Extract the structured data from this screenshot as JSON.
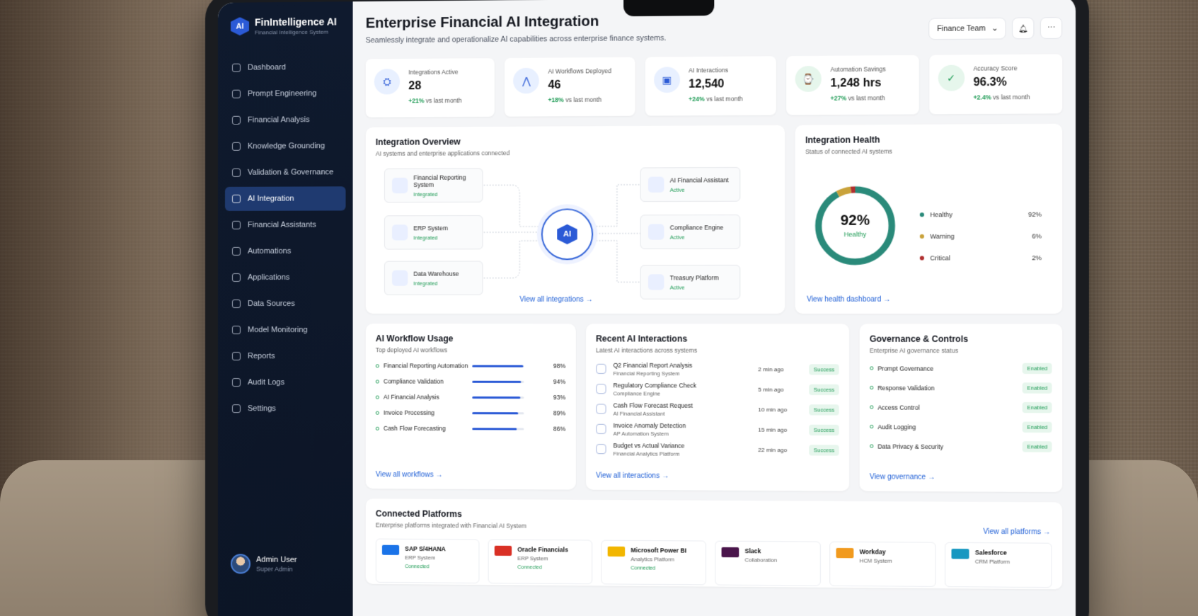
{
  "brand": {
    "name": "FinIntelligence AI",
    "sub": "Financial Intelligence System",
    "logo": "AI"
  },
  "nav": [
    {
      "label": "Dashboard",
      "icon": "home-icon"
    },
    {
      "label": "Prompt Engineering",
      "icon": "prompt-icon"
    },
    {
      "label": "Financial Analysis",
      "icon": "chart-icon"
    },
    {
      "label": "Knowledge Grounding",
      "icon": "knowledge-icon"
    },
    {
      "label": "Validation & Governance",
      "icon": "shield-icon"
    },
    {
      "label": "AI Integration",
      "icon": "integration-icon",
      "active": true
    },
    {
      "label": "Financial Assistants",
      "icon": "assistant-icon"
    },
    {
      "label": "Automations",
      "icon": "automation-icon"
    },
    {
      "label": "Applications",
      "icon": "apps-icon"
    },
    {
      "label": "Data Sources",
      "icon": "database-icon"
    },
    {
      "label": "Model Monitoring",
      "icon": "monitor-icon"
    },
    {
      "label": "Reports",
      "icon": "report-icon"
    },
    {
      "label": "Audit Logs",
      "icon": "log-icon"
    },
    {
      "label": "Settings",
      "icon": "gear-icon"
    }
  ],
  "user": {
    "name": "Admin User",
    "role": "Super Admin"
  },
  "header": {
    "title": "Enterprise Financial AI Integration",
    "subtitle": "Seamlessly integrate and operationalize AI capabilities across enterprise finance systems.",
    "team": "Finance Team"
  },
  "stats": [
    {
      "label": "Integrations Active",
      "value": "28",
      "delta": "+21%",
      "suffix": "vs last month",
      "color": "#e8f0ff",
      "ic": "⛭"
    },
    {
      "label": "AI Workflows Deployed",
      "value": "46",
      "delta": "+18%",
      "suffix": "vs last month",
      "color": "#e8f0ff",
      "ic": "⋀"
    },
    {
      "label": "AI Interactions",
      "value": "12,540",
      "delta": "+24%",
      "suffix": "vs last month",
      "color": "#e8f0ff",
      "ic": "▣"
    },
    {
      "label": "Automation Savings",
      "value": "1,248 hrs",
      "delta": "+27%",
      "suffix": "vs last month",
      "color": "#e6f6ec",
      "ic": "⌚"
    },
    {
      "label": "Accuracy Score",
      "value": "96.3%",
      "delta": "+2.4%",
      "suffix": "vs last month",
      "color": "#e6f6ec",
      "ic": "✓"
    }
  ],
  "overview": {
    "title": "Integration Overview",
    "subtitle": "AI systems and enterprise applications connected",
    "hub": "AI",
    "left": [
      {
        "name": "Financial Reporting System",
        "status": "Integrated"
      },
      {
        "name": "ERP System",
        "status": "Integrated"
      },
      {
        "name": "Data Warehouse",
        "status": "Integrated"
      }
    ],
    "right": [
      {
        "name": "AI Financial Assistant",
        "status": "Active"
      },
      {
        "name": "Compliance Engine",
        "status": "Active"
      },
      {
        "name": "Treasury Platform",
        "status": "Active"
      }
    ],
    "link": "View all integrations →"
  },
  "health": {
    "title": "Integration Health",
    "subtitle": "Status of connected AI systems",
    "center_value": "92%",
    "center_label": "Healthy",
    "items": [
      {
        "label": "Healthy",
        "pct": "92%",
        "value": 92,
        "color": "#2a8a7a"
      },
      {
        "label": "Warning",
        "pct": "6%",
        "value": 6,
        "color": "#c9a23a"
      },
      {
        "label": "Critical",
        "pct": "2%",
        "value": 2,
        "color": "#b03030"
      }
    ],
    "link": "View health dashboard →"
  },
  "workflow": {
    "title": "AI Workflow Usage",
    "subtitle": "Top deployed AI workflows",
    "items": [
      {
        "name": "Financial Reporting Automation",
        "pct": "98%",
        "value": 98
      },
      {
        "name": "Compliance Validation",
        "pct": "94%",
        "value": 94
      },
      {
        "name": "AI Financial Analysis",
        "pct": "93%",
        "value": 93
      },
      {
        "name": "Invoice Processing",
        "pct": "89%",
        "value": 89
      },
      {
        "name": "Cash Flow Forecasting",
        "pct": "86%",
        "value": 86
      }
    ],
    "link": "View all workflows →"
  },
  "recent": {
    "title": "Recent AI Interactions",
    "subtitle": "Latest AI interactions across systems",
    "items": [
      {
        "title": "Q2 Financial Report Analysis",
        "src": "Financial Reporting System",
        "time": "2 min ago",
        "status": "Success"
      },
      {
        "title": "Regulatory Compliance Check",
        "src": "Compliance Engine",
        "time": "5 min ago",
        "status": "Success"
      },
      {
        "title": "Cash Flow Forecast Request",
        "src": "AI Financial Assistant",
        "time": "10 min ago",
        "status": "Success"
      },
      {
        "title": "Invoice Anomaly Detection",
        "src": "AP Automation System",
        "time": "15 min ago",
        "status": "Success"
      },
      {
        "title": "Budget vs Actual Variance",
        "src": "Financial Analytics Platform",
        "time": "22 min ago",
        "status": "Success"
      }
    ],
    "link": "View all interactions →"
  },
  "governance": {
    "title": "Governance & Controls",
    "subtitle": "Enterprise AI governance status",
    "items": [
      {
        "name": "Prompt Governance",
        "status": "Enabled"
      },
      {
        "name": "Response Validation",
        "status": "Enabled"
      },
      {
        "name": "Access Control",
        "status": "Enabled"
      },
      {
        "name": "Audit Logging",
        "status": "Enabled"
      },
      {
        "name": "Data Privacy & Security",
        "status": "Enabled"
      }
    ],
    "link": "View governance →"
  },
  "platforms": {
    "title": "Connected Platforms",
    "subtitle": "Enterprise platforms integrated with Financial AI System",
    "link": "View all platforms →",
    "items": [
      {
        "name": "SAP S/4HANA",
        "type": "ERP System",
        "status": "Connected",
        "color": "#1a73e8"
      },
      {
        "name": "Oracle Financials",
        "type": "ERP System",
        "status": "Connected",
        "color": "#d93025"
      },
      {
        "name": "Microsoft Power BI",
        "type": "Analytics Platform",
        "status": "Connected",
        "color": "#f2b600"
      },
      {
        "name": "Slack",
        "type": "Collaboration",
        "status": "",
        "color": "#4a154b"
      },
      {
        "name": "Workday",
        "type": "HCM System",
        "status": "",
        "color": "#f19a1e"
      },
      {
        "name": "Salesforce",
        "type": "CRM Platform",
        "status": "",
        "color": "#1798c1"
      }
    ]
  }
}
